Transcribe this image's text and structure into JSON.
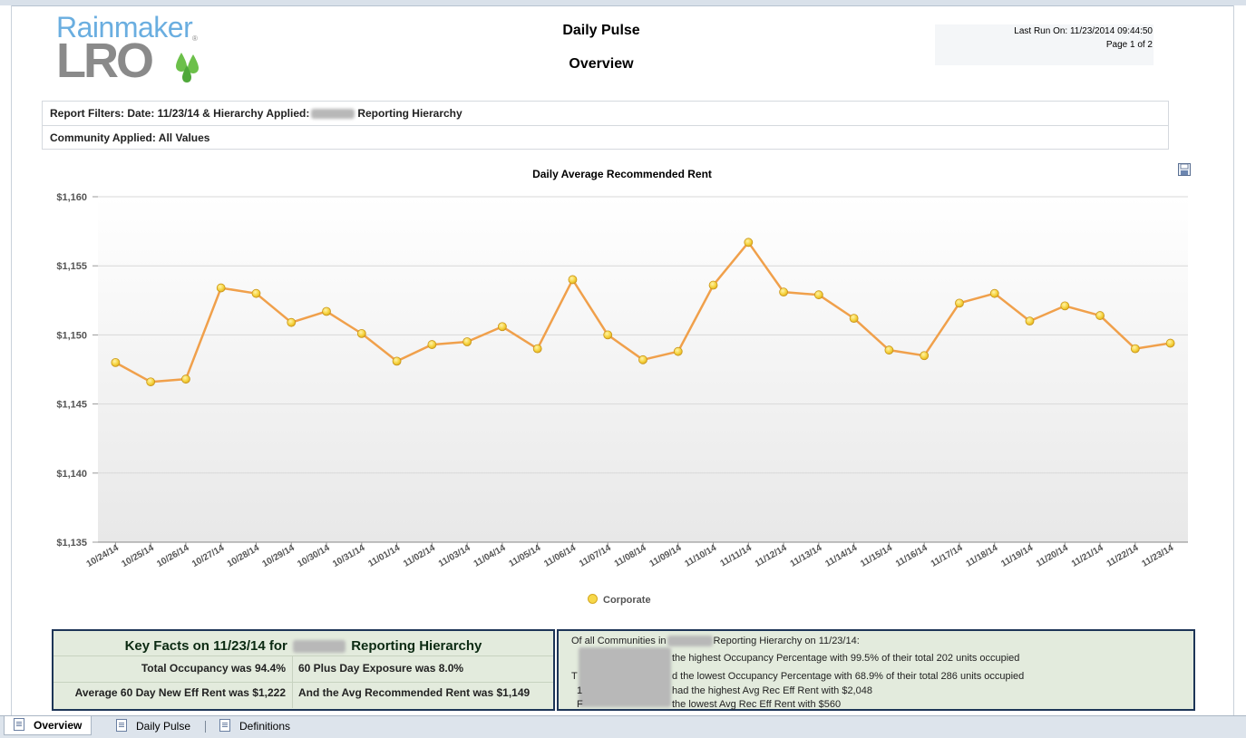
{
  "logo": {
    "top": "Rainmaker",
    "bottom": "LRO",
    "mark": "®"
  },
  "header": {
    "title": "Daily Pulse",
    "subtitle": "Overview",
    "last_run": "Last Run On: 11/23/2014 09:44:50",
    "page": "Page 1 of 2"
  },
  "filters": {
    "row1_prefix": "Report Filters: Date: 11/23/14 & Hierarchy Applied:",
    "row1_suffix": "Reporting Hierarchy",
    "row2": "Community Applied: All Values"
  },
  "icons": {
    "save": "save-icon"
  },
  "chart_data": {
    "type": "line",
    "title": "Daily Average Recommended Rent",
    "xlabel": "",
    "ylabel": "",
    "ylim": [
      1135,
      1160
    ],
    "yticks": [
      "$1,135",
      "$1,140",
      "$1,145",
      "$1,150",
      "$1,155",
      "$1,160"
    ],
    "ytick_values": [
      1135,
      1140,
      1145,
      1150,
      1155,
      1160
    ],
    "grid": true,
    "legend_position": "bottom",
    "categories": [
      "10/24/14",
      "10/25/14",
      "10/26/14",
      "10/27/14",
      "10/28/14",
      "10/29/14",
      "10/30/14",
      "10/31/14",
      "11/01/14",
      "11/02/14",
      "11/03/14",
      "11/04/14",
      "11/05/14",
      "11/06/14",
      "11/07/14",
      "11/08/14",
      "11/09/14",
      "11/10/14",
      "11/11/14",
      "11/12/14",
      "11/13/14",
      "11/14/14",
      "11/15/14",
      "11/16/14",
      "11/17/14",
      "11/18/14",
      "11/19/14",
      "11/20/14",
      "11/21/14",
      "11/22/14",
      "11/23/14"
    ],
    "series": [
      {
        "name": "Corporate",
        "color": "#f0a04b",
        "marker_color": "#f7d84a",
        "values": [
          1148.0,
          1146.6,
          1146.8,
          1153.4,
          1153.0,
          1150.9,
          1151.7,
          1150.1,
          1148.1,
          1149.3,
          1149.5,
          1150.6,
          1149.0,
          1154.0,
          1150.0,
          1148.2,
          1148.8,
          1153.6,
          1156.7,
          1153.1,
          1152.9,
          1151.2,
          1148.9,
          1148.5,
          1152.3,
          1153.0,
          1151.0,
          1152.1,
          1151.4,
          1149.0,
          1149.4
        ]
      }
    ]
  },
  "key_facts": {
    "title_prefix": "Key Facts on 11/23/14 for",
    "title_suffix": "Reporting Hierarchy",
    "occupancy": "Total Occupancy was 94.4%",
    "exposure": "60 Plus Day Exposure was 8.0%",
    "new_eff_rent": "Average 60 Day New Eff Rent was $1,222",
    "avg_rec_rent": "And the Avg Recommended Rent was $1,149"
  },
  "communities": {
    "intro_prefix": "Of all Communities in",
    "intro_suffix": "Reporting Hierarchy on 11/23/14:",
    "line1": "the highest Occupancy Percentage with 99.5% of their  total 202 units occupied",
    "line2": "d the lowest Occupancy Percentage with 68.9% of their total 286  units occupied",
    "line3": "had the highest Avg Rec Eff Rent with $2,048",
    "line4": "the lowest Avg Rec Eff Rent with $560",
    "line2_lead": "T",
    "line3_lead": "1",
    "line4_lead": "F"
  },
  "tabs": [
    {
      "label": "Overview",
      "active": true
    },
    {
      "label": "Daily Pulse",
      "active": false
    },
    {
      "label": "Definitions",
      "active": false
    }
  ]
}
